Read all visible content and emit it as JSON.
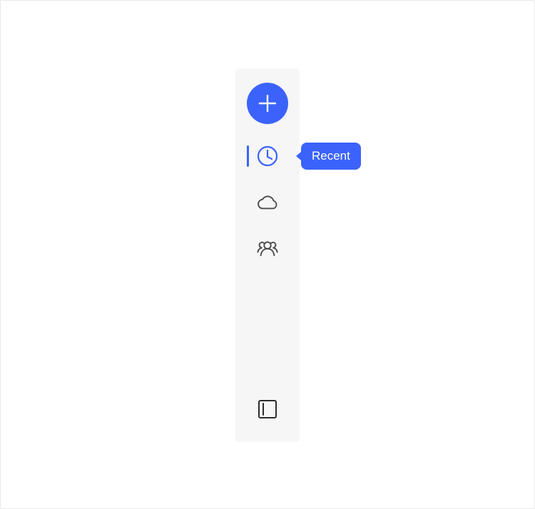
{
  "colors": {
    "accent": "#3b63fb",
    "rail_background": "#f6f6f6",
    "icon_default": "#4b4b4b",
    "icon_selected": "#3b63fb"
  },
  "rail": {
    "create_button": {
      "icon": "plus-icon"
    },
    "items": [
      {
        "id": "recent",
        "icon": "clock-icon",
        "selected": true
      },
      {
        "id": "cloud",
        "icon": "cloud-icon",
        "selected": false
      },
      {
        "id": "shared",
        "icon": "people-icon",
        "selected": false
      }
    ],
    "footer": {
      "icon": "panel-toggle-icon"
    }
  },
  "tooltip": {
    "text": "Recent"
  }
}
